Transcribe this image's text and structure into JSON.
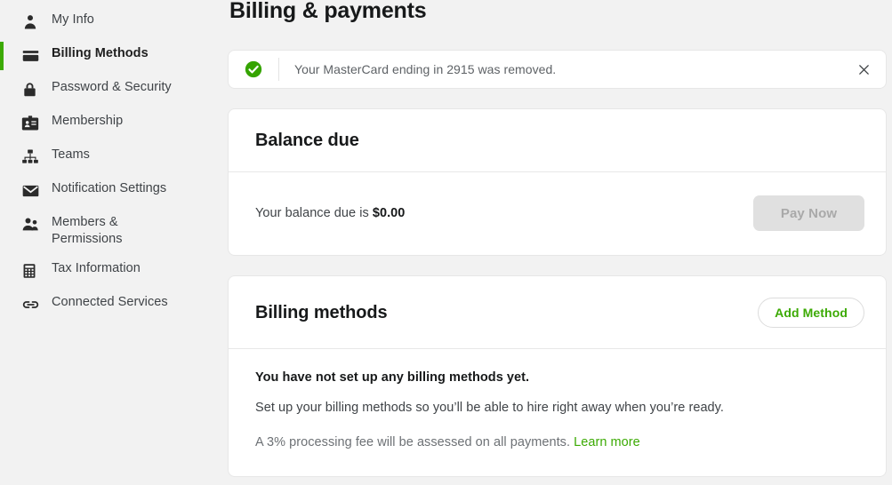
{
  "sidebar": {
    "items": [
      {
        "label": "My Info",
        "icon": "person-icon",
        "active": false
      },
      {
        "label": "Billing Methods",
        "icon": "credit-card-icon",
        "active": true
      },
      {
        "label": "Password & Security",
        "icon": "lock-icon",
        "active": false
      },
      {
        "label": "Membership",
        "icon": "id-card-icon",
        "active": false
      },
      {
        "label": "Teams",
        "icon": "org-chart-icon",
        "active": false
      },
      {
        "label": "Notification Settings",
        "icon": "envelope-icon",
        "active": false
      },
      {
        "label": "Members & Permissions",
        "icon": "people-icon",
        "active": false
      },
      {
        "label": "Tax Information",
        "icon": "calculator-icon",
        "active": false
      },
      {
        "label": "Connected Services",
        "icon": "link-icon",
        "active": false
      }
    ],
    "active_indicator_color": "#3caa04"
  },
  "header": {
    "title": "Billing & payments"
  },
  "alert": {
    "icon": "success-check-icon",
    "message": "Your MasterCard ending in 2915 was removed.",
    "close_label": "×",
    "status_color": "#3caa04"
  },
  "balance_card": {
    "title": "Balance due",
    "text_prefix": "Your balance due is ",
    "amount": "$0.00",
    "pay_button_label": "Pay Now",
    "pay_button_disabled": true
  },
  "methods_card": {
    "title": "Billing methods",
    "add_button_label": "Add Method",
    "headline": "You have not set up any billing methods yet.",
    "description": "Set up your billing methods so you’ll be able to hire right away when you’re ready.",
    "fee_text": "A 3% processing fee will be assessed on all payments. ",
    "fee_link_label": "Learn more",
    "accent_color": "#3caa04"
  }
}
